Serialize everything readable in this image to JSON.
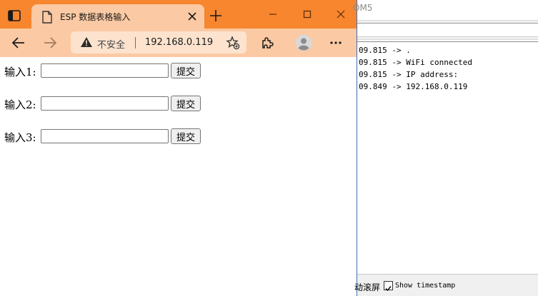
{
  "browser": {
    "tab": {
      "title": "ESP 数据表格输入",
      "close_icon": "close-icon",
      "page_icon": "page-icon"
    },
    "toolbar": {
      "security_label": "不安全",
      "url": "192.168.0.119",
      "icons": [
        "back-arrow-icon",
        "forward-arrow-icon",
        "warning-icon",
        "favorites-star-icon",
        "extensions-icon",
        "profile-avatar-icon",
        "more-options-icon"
      ]
    },
    "window_controls": [
      "minimize-icon",
      "maximize-icon",
      "close-icon"
    ],
    "accent_color": "#f7862e",
    "tab_color": "#fbc9a3"
  },
  "form": {
    "fields": [
      {
        "label": "输入1:",
        "value": "",
        "button": "提交"
      },
      {
        "label": "输入2:",
        "value": "",
        "button": "提交"
      },
      {
        "label": "输入3:",
        "value": "",
        "button": "提交"
      }
    ]
  },
  "serial_monitor": {
    "title_fragment": "OM5",
    "lines": [
      "09.815 -> .",
      "09.815 -> WiFi connected",
      "09.815 -> IP address:",
      "09.849 -> 192.168.0.119"
    ],
    "autoscroll_label": "动滚屏",
    "show_timestamp_label": "Show timestamp",
    "show_timestamp_checked": true
  }
}
